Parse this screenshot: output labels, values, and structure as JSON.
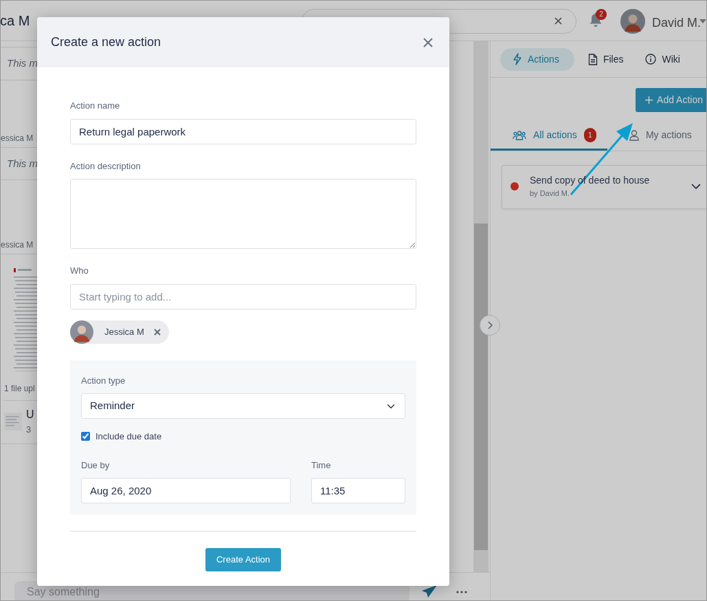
{
  "header": {
    "conversation_title": "ca M",
    "notification_count": "2",
    "user_name": "David M."
  },
  "chat": {
    "messages": [
      {
        "kind": "text",
        "text": "This m"
      },
      {
        "kind": "text",
        "sender": "essica M",
        "text": "This m"
      },
      {
        "kind": "file",
        "sender": "essica M",
        "caption": "1 file upl",
        "file_name": "U",
        "file_meta": "3"
      }
    ],
    "composer": {
      "placeholder": "Say something"
    }
  },
  "side_panel": {
    "tabs": [
      {
        "label": "Actions",
        "selected": true
      },
      {
        "label": "Files",
        "selected": false
      },
      {
        "label": "Wiki",
        "selected": false
      }
    ],
    "add_button": "Add Action",
    "filters": [
      {
        "label": "All actions",
        "badge": "1",
        "selected": true
      },
      {
        "label": "My actions",
        "selected": false
      }
    ],
    "actions": [
      {
        "title": "Send copy of deed to house",
        "author": "by David M.",
        "color": "#b8281c"
      }
    ]
  },
  "dialog": {
    "title": "Create a new action",
    "name": {
      "label": "Action name",
      "value": "Return legal paperwork"
    },
    "description": {
      "label": "Action description"
    },
    "who": {
      "label": "Who",
      "placeholder": "Start typing to add...",
      "people": [
        {
          "name": "Jessica M"
        }
      ]
    },
    "type": {
      "label": "Action type",
      "value": "Reminder"
    },
    "include_due_date": {
      "label": "Include due date",
      "checked": true
    },
    "due_by": {
      "label": "Due by",
      "value": "Aug 26, 2020"
    },
    "time": {
      "label": "Time",
      "value": "11:35"
    },
    "submit": "Create Action"
  }
}
